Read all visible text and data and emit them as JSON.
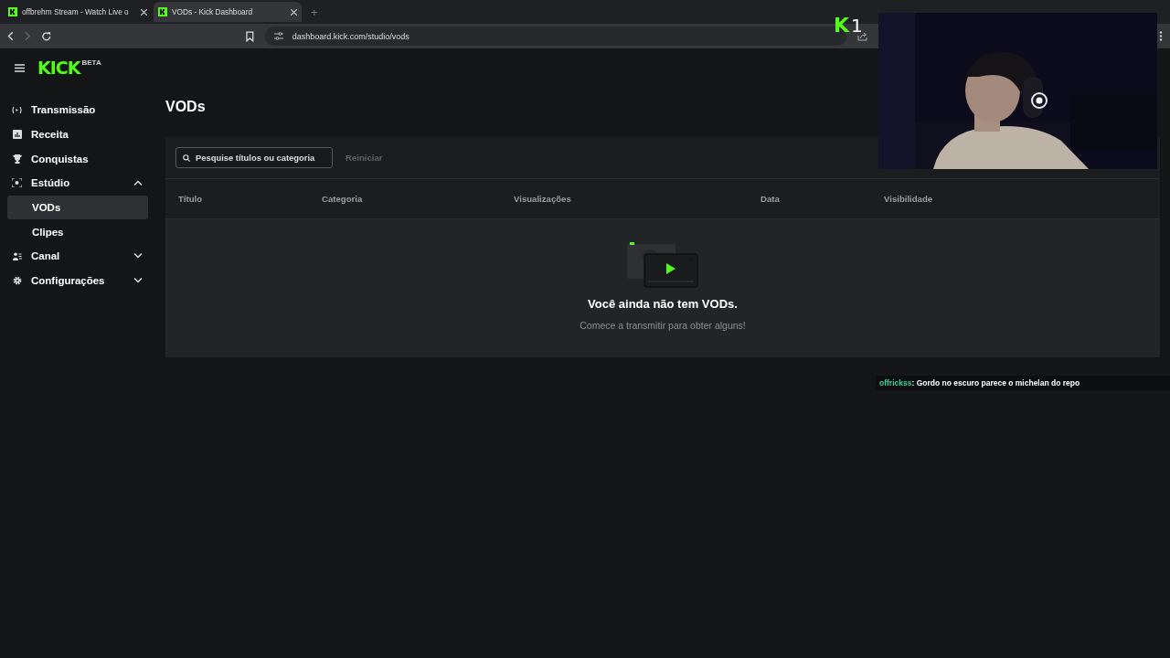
{
  "browser": {
    "tabs": [
      {
        "title": "offbrehm Stream - Watch Live o",
        "selected": false
      },
      {
        "title": "VODs - Kick Dashboard",
        "selected": true
      }
    ],
    "new_tab": "+",
    "url": "dashboard.kick.com/studio/vods"
  },
  "sidebar": {
    "logo": "KICK",
    "logo_badge": "BETA",
    "items": [
      {
        "label": "Transmissão",
        "selected": false
      },
      {
        "label": "Receita",
        "selected": false
      },
      {
        "label": "Conquistas",
        "selected": false
      },
      {
        "label": "Estúdio",
        "selected": false,
        "expanded": true,
        "children": [
          {
            "label": "VODs",
            "selected": true
          },
          {
            "label": "Clipes",
            "selected": false
          }
        ]
      },
      {
        "label": "Canal",
        "selected": false,
        "expanded": false
      },
      {
        "label": "Configurações",
        "selected": false,
        "expanded": false
      }
    ]
  },
  "page": {
    "title": "VODs",
    "search": {
      "placeholder": "Pesquise títulos ou categoria"
    },
    "reset_button": {
      "label": "Reiniciar",
      "disabled": true
    },
    "table": {
      "columns": [
        "Título",
        "Categoria",
        "Visualizações",
        "Data",
        "Visibilidade"
      ]
    },
    "empty_state": {
      "title": "Você ainda não tem VODs.",
      "subtitle": "Comece a transmitir para obter alguns!"
    }
  },
  "overlay": {
    "logo": "K",
    "viewer_count": "1",
    "chat": {
      "user": "offrickss",
      "message": ": Gordo no escuro parece o michelan do repo"
    }
  }
}
